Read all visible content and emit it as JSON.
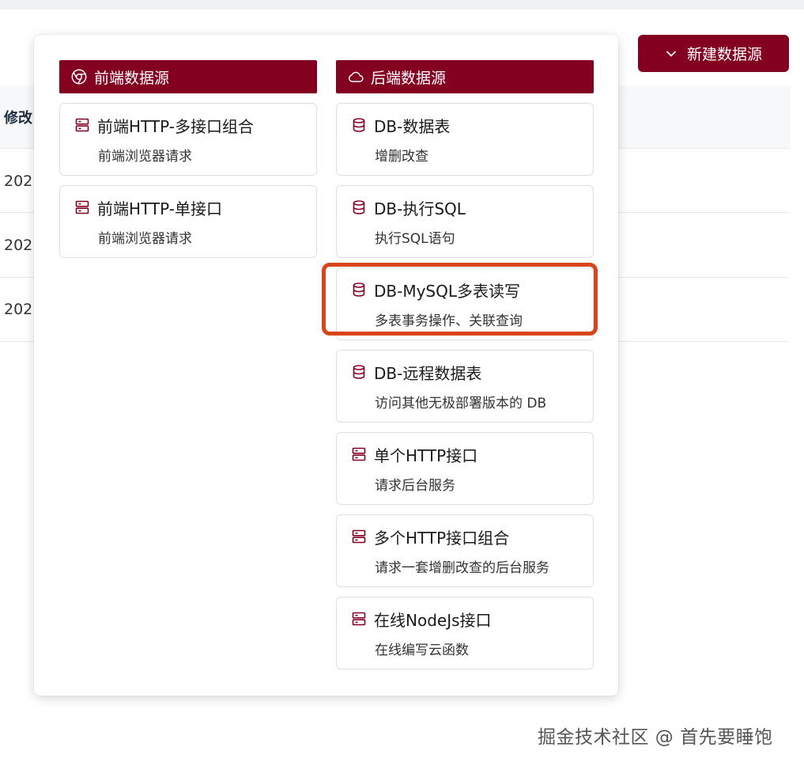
{
  "toolbar": {
    "new_button_label": "新建数据源"
  },
  "table": {
    "header_label": "修改",
    "rows": [
      "202",
      "202",
      "202"
    ]
  },
  "frontend": {
    "title": "前端数据源",
    "items": [
      {
        "title": "前端HTTP-多接口组合",
        "desc": "前端浏览器请求",
        "icon": "server-icon"
      },
      {
        "title": "前端HTTP-单接口",
        "desc": "前端浏览器请求",
        "icon": "server-icon"
      }
    ]
  },
  "backend": {
    "title": "后端数据源",
    "items": [
      {
        "title": "DB-数据表",
        "desc": "增删改查",
        "icon": "database-icon"
      },
      {
        "title": "DB-执行SQL",
        "desc": "执行SQL语句",
        "icon": "database-icon"
      },
      {
        "title": "DB-MySQL多表读写",
        "desc": "多表事务操作、关联查询",
        "icon": "database-icon"
      },
      {
        "title": "DB-远程数据表",
        "desc": "访问其他无极部署版本的 DB",
        "icon": "database-icon"
      },
      {
        "title": "单个HTTP接口",
        "desc": "请求后台服务",
        "icon": "server-icon"
      },
      {
        "title": "多个HTTP接口组合",
        "desc": "请求一套增删改查的后台服务",
        "icon": "server-icon"
      },
      {
        "title": "在线NodeJs接口",
        "desc": "在线编写云函数",
        "icon": "server-icon"
      }
    ]
  },
  "watermark": "掘金技术社区 @ 首先要睡饱",
  "colors": {
    "brand": "#840021",
    "highlight": "#d8451b",
    "border": "#dcdfe6"
  }
}
